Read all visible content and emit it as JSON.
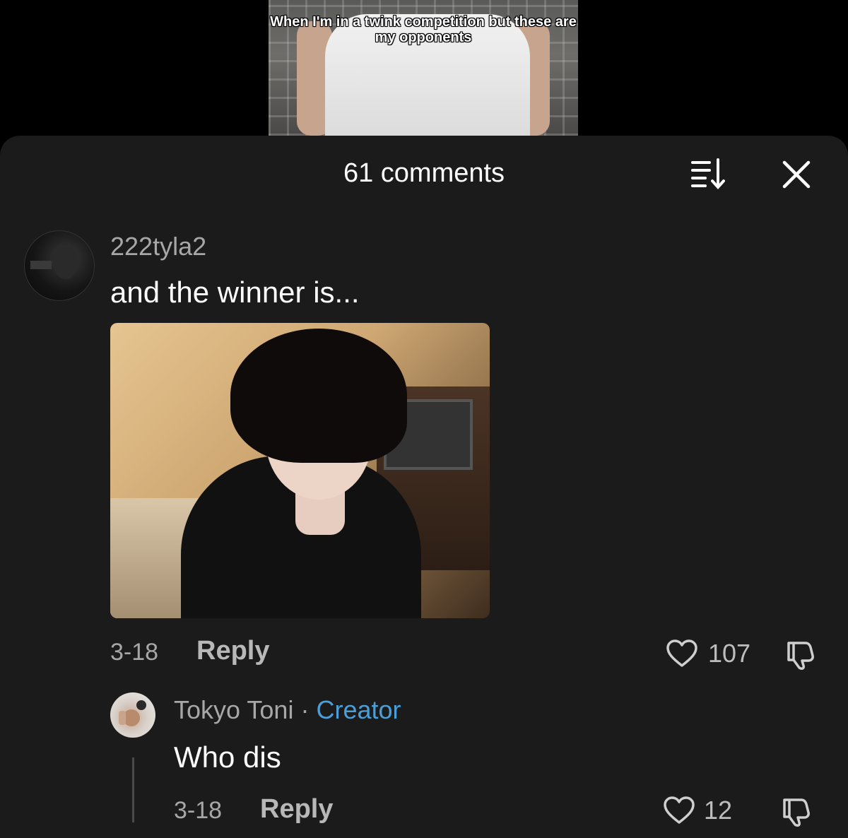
{
  "video": {
    "caption": "When I'm in a twink competition but these are my opponents"
  },
  "sheet": {
    "title": "61 comments",
    "sort_icon": "sort-icon",
    "close_icon": "close-icon"
  },
  "comments": [
    {
      "username": "222tyla2",
      "text": "and the winner is...",
      "has_image": true,
      "date": "3-18",
      "reply_label": "Reply",
      "likes": "107"
    }
  ],
  "replies": [
    {
      "username": "Tokyo Toni",
      "separator": "·",
      "badge": "Creator",
      "text": "Who dis",
      "date": "3-18",
      "reply_label": "Reply",
      "likes": "12"
    }
  ],
  "colors": {
    "sheet_bg": "#1b1b1b",
    "creator_badge": "#4c9ed6",
    "secondary_text": "#a7a7a7"
  }
}
